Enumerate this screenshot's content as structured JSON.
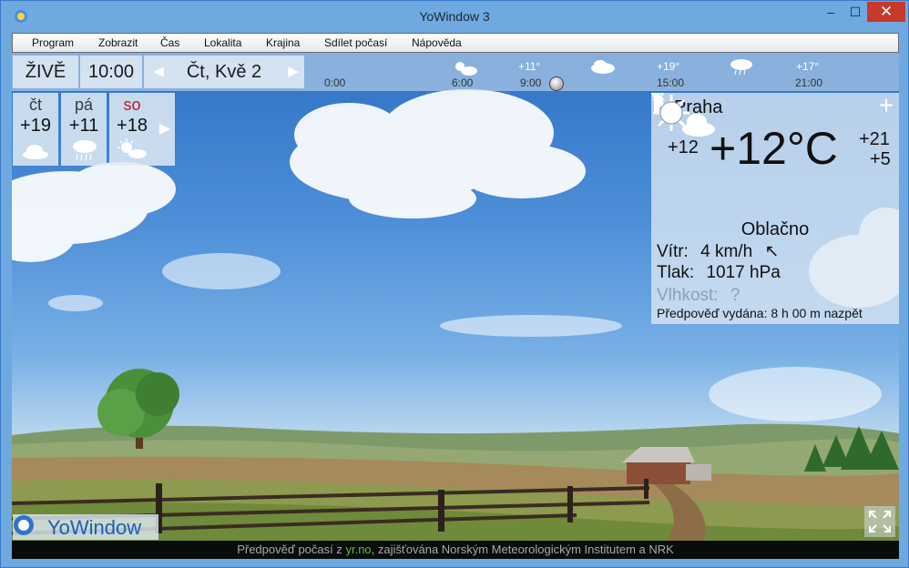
{
  "window": {
    "title": "YoWindow 3",
    "minimize": "–",
    "maximize": "☐",
    "close": "✕"
  },
  "menu": [
    "Program",
    "Zobrazit",
    "Čas",
    "Lokalita",
    "Krajina",
    "Sdílet počasí",
    "Nápověda"
  ],
  "timebar": {
    "live": "ŽIVĚ",
    "time": "10:00",
    "date": "Čt, Kvě 2",
    "prev": "◀",
    "next": "▶",
    "labels": [
      "0:00",
      "6:00",
      "9:00",
      "15:00",
      "21:00"
    ],
    "temps": [
      "+11°",
      "+19°",
      "+17°"
    ]
  },
  "days": [
    {
      "name": "čt",
      "temp": "+19",
      "icon": "cloud-icon",
      "weekend": false
    },
    {
      "name": "pá",
      "temp": "+11",
      "icon": "rain-cloud-icon",
      "weekend": false
    },
    {
      "name": "so",
      "temp": "+18",
      "icon": "sun-cloud-icon",
      "weekend": true
    }
  ],
  "days_next": "▶",
  "current": {
    "location": "Praha",
    "add": "+",
    "feels_like": "+12",
    "temperature": "+12°C",
    "high": "+21",
    "low": "+5",
    "condition": "Oblačno",
    "wind_label": "Vítr:",
    "wind_value": "4 km/h",
    "wind_arrow": "↖",
    "pressure_label": "Tlak:",
    "pressure_value": "1017 hPa",
    "humidity_label": "Vlhkost:",
    "humidity_value": "?",
    "issued_label": "Předpověď vydána:",
    "issued_value": "8 h 00 m nazpět"
  },
  "brand": {
    "name": "YoWindow"
  },
  "footer": {
    "prefix": "Předpověď počasí z ",
    "link": "yr.no",
    "suffix": ", zajišťována Norským Meteorologickým Institutem a NRK"
  },
  "colors": {
    "sky_top": "#2f72c4",
    "accent_red": "#c3141b",
    "link_green": "#5fbf3a",
    "close_red": "#c7392b"
  }
}
